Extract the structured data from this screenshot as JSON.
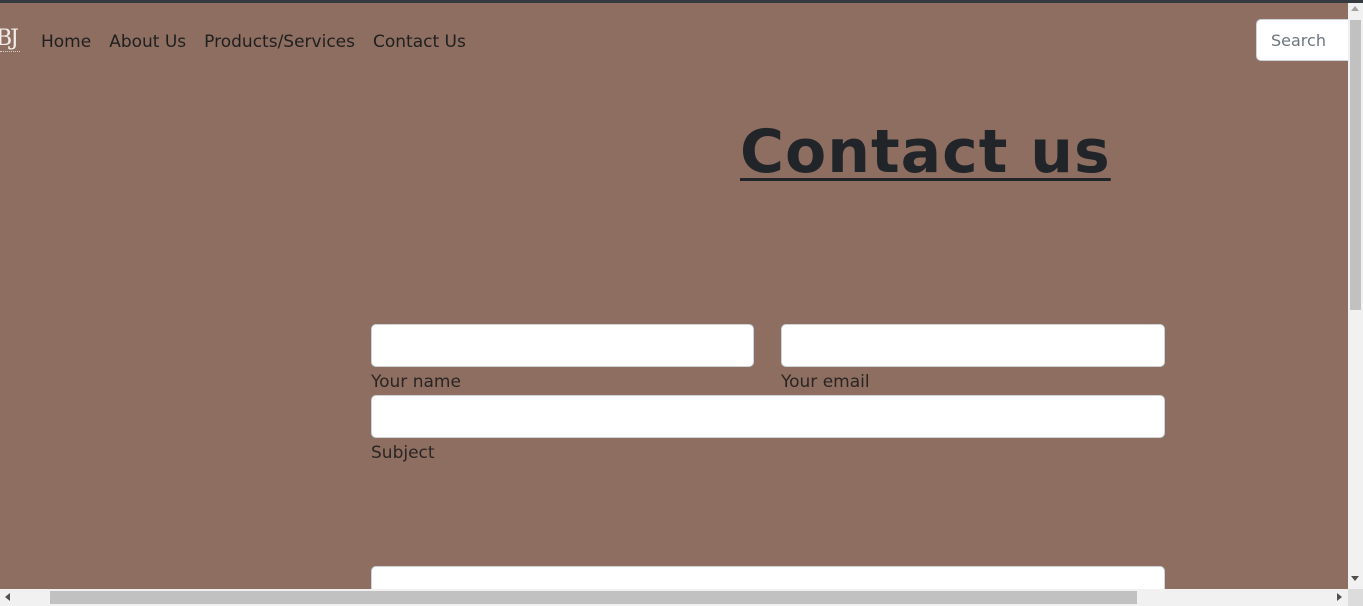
{
  "colors": {
    "page_background": "#8d6e61",
    "heading": "#212529",
    "top_border": "#343a40"
  },
  "brand": {
    "logo_text": "BJ"
  },
  "nav": {
    "items": [
      {
        "label": "Home"
      },
      {
        "label": "About Us"
      },
      {
        "label": "Products/Services"
      },
      {
        "label": "Contact Us"
      }
    ],
    "search_placeholder": "Search"
  },
  "main": {
    "title": "Contact us",
    "form": {
      "name_label": "Your name",
      "name_value": "",
      "email_label": "Your email",
      "email_value": "",
      "subject_label": "Subject",
      "subject_value": "",
      "message_value": ""
    }
  }
}
